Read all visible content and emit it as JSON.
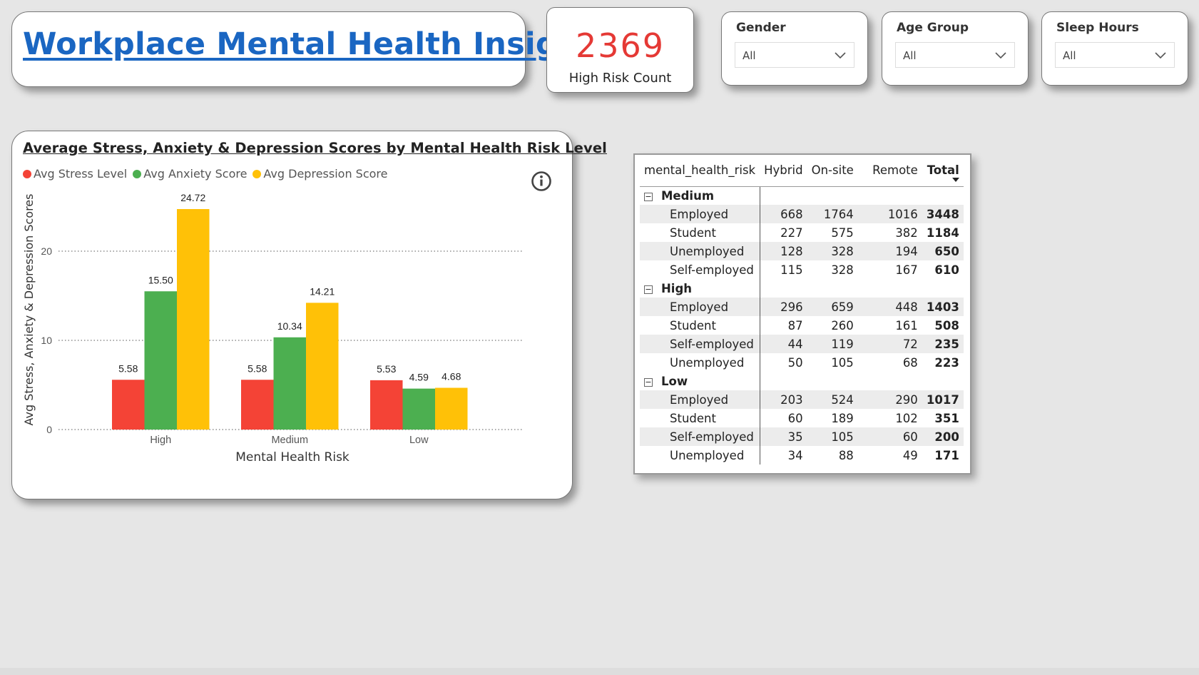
{
  "header": {
    "title": "Workplace Mental Health Insights"
  },
  "kpi": {
    "value": "2369",
    "label": "High Risk Count"
  },
  "slicers": {
    "gender": {
      "title": "Gender",
      "value": "All"
    },
    "age_group": {
      "title": "Age Group",
      "value": "All"
    },
    "sleep_hours": {
      "title": "Sleep Hours",
      "value": "All"
    }
  },
  "colors": {
    "accent_title": "#1a66c2",
    "kpi": "#e53935",
    "stress": "#f44336",
    "anxiety": "#4caf50",
    "depression": "#ffc107"
  },
  "chart_data": {
    "type": "bar",
    "title": "Average Stress, Anxiety & Depression Scores by Mental Health Risk Level",
    "xlabel": "Mental Health Risk",
    "ylabel": "Avg Stress, Anxiety & Depression Scores",
    "categories": [
      "High",
      "Medium",
      "Low"
    ],
    "series": [
      {
        "name": "Avg Stress Level",
        "values": [
          5.58,
          5.58,
          5.53
        ],
        "labels": [
          "5.58",
          "5.58",
          "5.53"
        ]
      },
      {
        "name": "Avg Anxiety Score",
        "values": [
          15.5,
          10.34,
          4.59
        ],
        "labels": [
          "15.50",
          "10.34",
          "4.59"
        ]
      },
      {
        "name": "Avg Depression Score",
        "values": [
          24.72,
          14.21,
          4.68
        ],
        "labels": [
          "24.72",
          "14.21",
          "4.68"
        ]
      }
    ],
    "ylim": [
      0,
      25
    ],
    "yticks": [
      0,
      10,
      20
    ],
    "grid": true,
    "legend": "top-left"
  },
  "matrix": {
    "columns": [
      "mental_health_risk",
      "Hybrid",
      "On-site",
      "Remote",
      "Total"
    ],
    "groups": [
      {
        "name": "Medium",
        "rows": [
          {
            "label": "Employed",
            "values": [
              "668",
              "1764",
              "1016",
              "3448"
            ]
          },
          {
            "label": "Student",
            "values": [
              "227",
              "575",
              "382",
              "1184"
            ]
          },
          {
            "label": "Unemployed",
            "values": [
              "128",
              "328",
              "194",
              "650"
            ]
          },
          {
            "label": "Self-employed",
            "values": [
              "115",
              "328",
              "167",
              "610"
            ]
          }
        ]
      },
      {
        "name": "High",
        "rows": [
          {
            "label": "Employed",
            "values": [
              "296",
              "659",
              "448",
              "1403"
            ]
          },
          {
            "label": "Student",
            "values": [
              "87",
              "260",
              "161",
              "508"
            ]
          },
          {
            "label": "Self-employed",
            "values": [
              "44",
              "119",
              "72",
              "235"
            ]
          },
          {
            "label": "Unemployed",
            "values": [
              "50",
              "105",
              "68",
              "223"
            ]
          }
        ]
      },
      {
        "name": "Low",
        "rows": [
          {
            "label": "Employed",
            "values": [
              "203",
              "524",
              "290",
              "1017"
            ]
          },
          {
            "label": "Student",
            "values": [
              "60",
              "189",
              "102",
              "351"
            ]
          },
          {
            "label": "Self-employed",
            "values": [
              "35",
              "105",
              "60",
              "200"
            ]
          },
          {
            "label": "Unemployed",
            "values": [
              "34",
              "88",
              "49",
              "171"
            ]
          }
        ]
      }
    ]
  }
}
